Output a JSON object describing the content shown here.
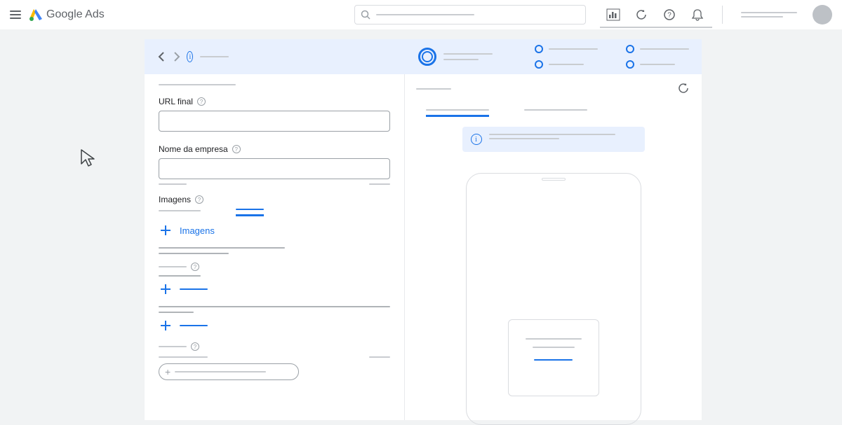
{
  "header": {
    "brand_first": "Google",
    "brand_second": "Ads"
  },
  "form": {
    "url_label": "URL final",
    "company_label": "Nome da empresa",
    "images_label": "Imagens",
    "add_images": "Imagens"
  }
}
